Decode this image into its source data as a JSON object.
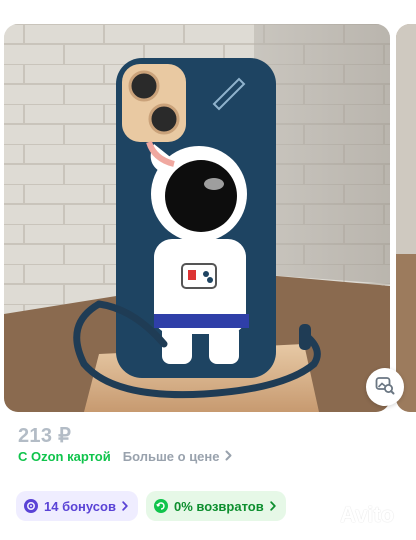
{
  "product": {
    "price": "213 ₽",
    "ozon_card_label": "С Ozon картой",
    "more_price_label": "Больше о цене"
  },
  "badges": {
    "bonus_label": "14 бонусов",
    "returns_label": "0% возвратов"
  },
  "watermark": {
    "text": "Avito"
  },
  "colors": {
    "price_gray": "#b3bcc6",
    "ozon_green": "#10c44c",
    "bonus_purple": "#5a43d6",
    "returns_green": "#0e8f2f"
  },
  "icons": {
    "similar": "image-search-icon",
    "chevron": "chevron-right-icon",
    "bonus": "bonus-coin-icon",
    "returns": "return-arrow-icon"
  }
}
